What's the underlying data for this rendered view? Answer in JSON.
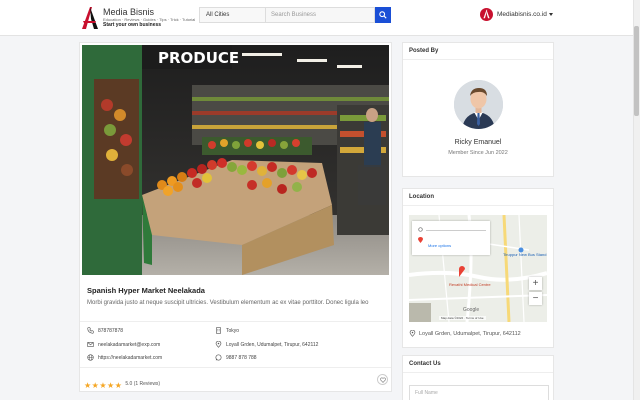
{
  "header": {
    "logo_title": "Media Bisnis",
    "logo_sub": "Education · Reviews · Guides · Tips · Trick · Tutorial",
    "logo_tagline": "Start your own business",
    "city_select": "All Cities",
    "search_placeholder": "Search Business",
    "account_name": "Mediabisnis.co.id"
  },
  "listing": {
    "title": "Spanish Hyper Market Neelakada",
    "description": "Morbi gravida justo at neque suscipit ultricies. Vestibulum elementum ac ex vitae porttitor. Donec ligula leo",
    "hero_sign": "PRODUCE",
    "phone": "878787878",
    "email": "neelakadamarket@exp.com",
    "website": "https://neelakadamarket.com",
    "city": "Tokyo",
    "address": "Loyall Grden, Udumalpet, Tirupur, 642112",
    "whatsapp": "9887 878 788",
    "rating_value": 5,
    "rating_text": "5.0 (1 Reviews)"
  },
  "posted_by": {
    "section_title": "Posted By",
    "name": "Ricky Emanuel",
    "member_since": "Member Since Jun 2022"
  },
  "location": {
    "section_title": "Location",
    "more_options": "More options",
    "map_labels": [
      "Revathi Medical Centre",
      "Tiruppur New Bus Stand",
      "Google",
      "Map data ©2022",
      "Terms of Use"
    ],
    "zoom_in": "+",
    "zoom_out": "−",
    "address": "Loyall Grden, Udumalpet, Tirupur, 642112"
  },
  "contact": {
    "section_title": "Contact Us",
    "full_name_placeholder": "Full Name"
  },
  "colors": {
    "brand_red": "#c8102e",
    "search_button": "#1a4fd6",
    "star": "#f5a623"
  }
}
